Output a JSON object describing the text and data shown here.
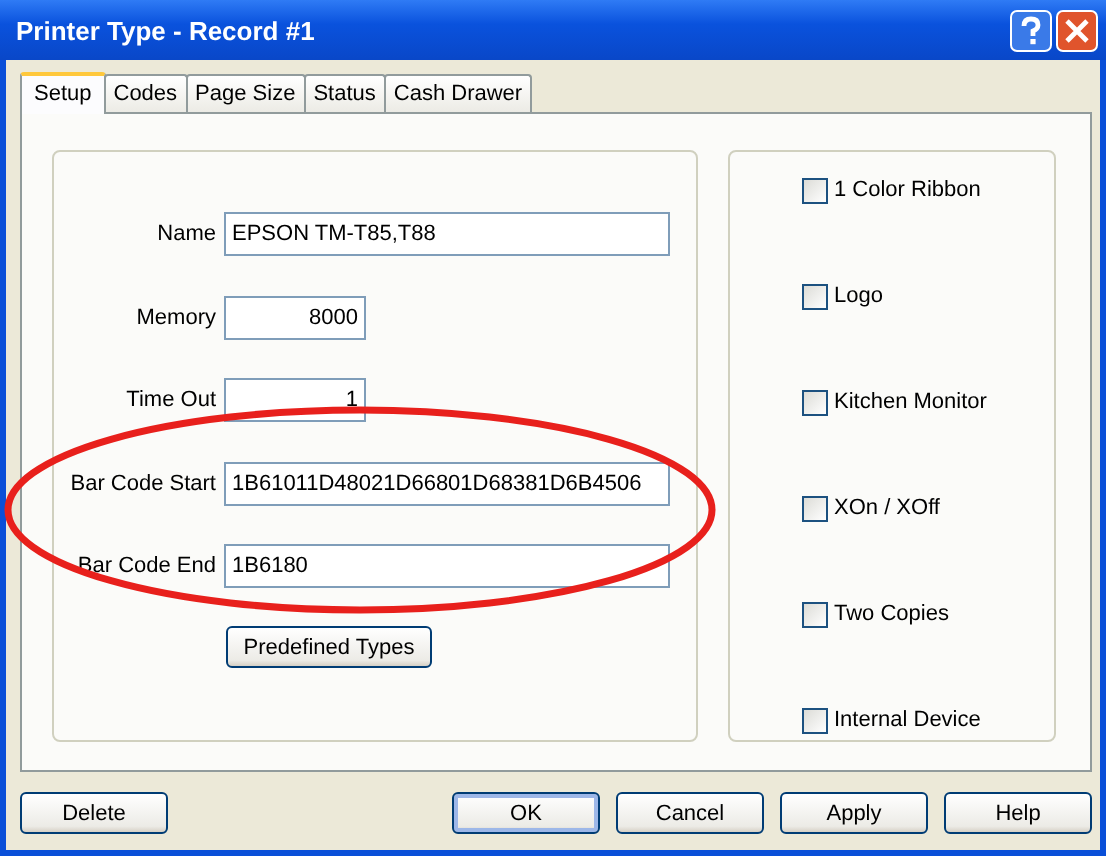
{
  "window": {
    "title": "Printer Type - Record #1"
  },
  "tabs": [
    {
      "label": "Setup",
      "selected": true
    },
    {
      "label": "Codes",
      "selected": false
    },
    {
      "label": "Page Size",
      "selected": false
    },
    {
      "label": "Status",
      "selected": false
    },
    {
      "label": "Cash Drawer",
      "selected": false
    }
  ],
  "fields": [
    {
      "label": "Name",
      "value": "EPSON TM-T85,T88",
      "kind": "text"
    },
    {
      "label": "Memory",
      "value": "8000",
      "kind": "number"
    },
    {
      "label": "Time Out",
      "value": "1",
      "kind": "number"
    },
    {
      "label": "Bar Code Start",
      "value": "1B61011D48021D66801D68381D6B4506",
      "kind": "text"
    },
    {
      "label": "Bar Code End",
      "value": "1B6180",
      "kind": "text"
    }
  ],
  "predefined_button": "Predefined Types",
  "options": [
    {
      "label": "1 Color Ribbon",
      "checked": false
    },
    {
      "label": "Logo",
      "checked": false
    },
    {
      "label": "Kitchen Monitor",
      "checked": false
    },
    {
      "label": "XOn / XOff",
      "checked": false
    },
    {
      "label": "Two Copies",
      "checked": false
    },
    {
      "label": "Internal Device",
      "checked": false
    }
  ],
  "annotations": [
    {
      "kind": "ellipse"
    }
  ],
  "buttons": [
    {
      "label": "Delete",
      "default": false
    },
    {
      "label": "OK",
      "default": true
    },
    {
      "label": "Cancel",
      "default": false
    },
    {
      "label": "Apply",
      "default": false
    },
    {
      "label": "Help",
      "default": false
    }
  ]
}
